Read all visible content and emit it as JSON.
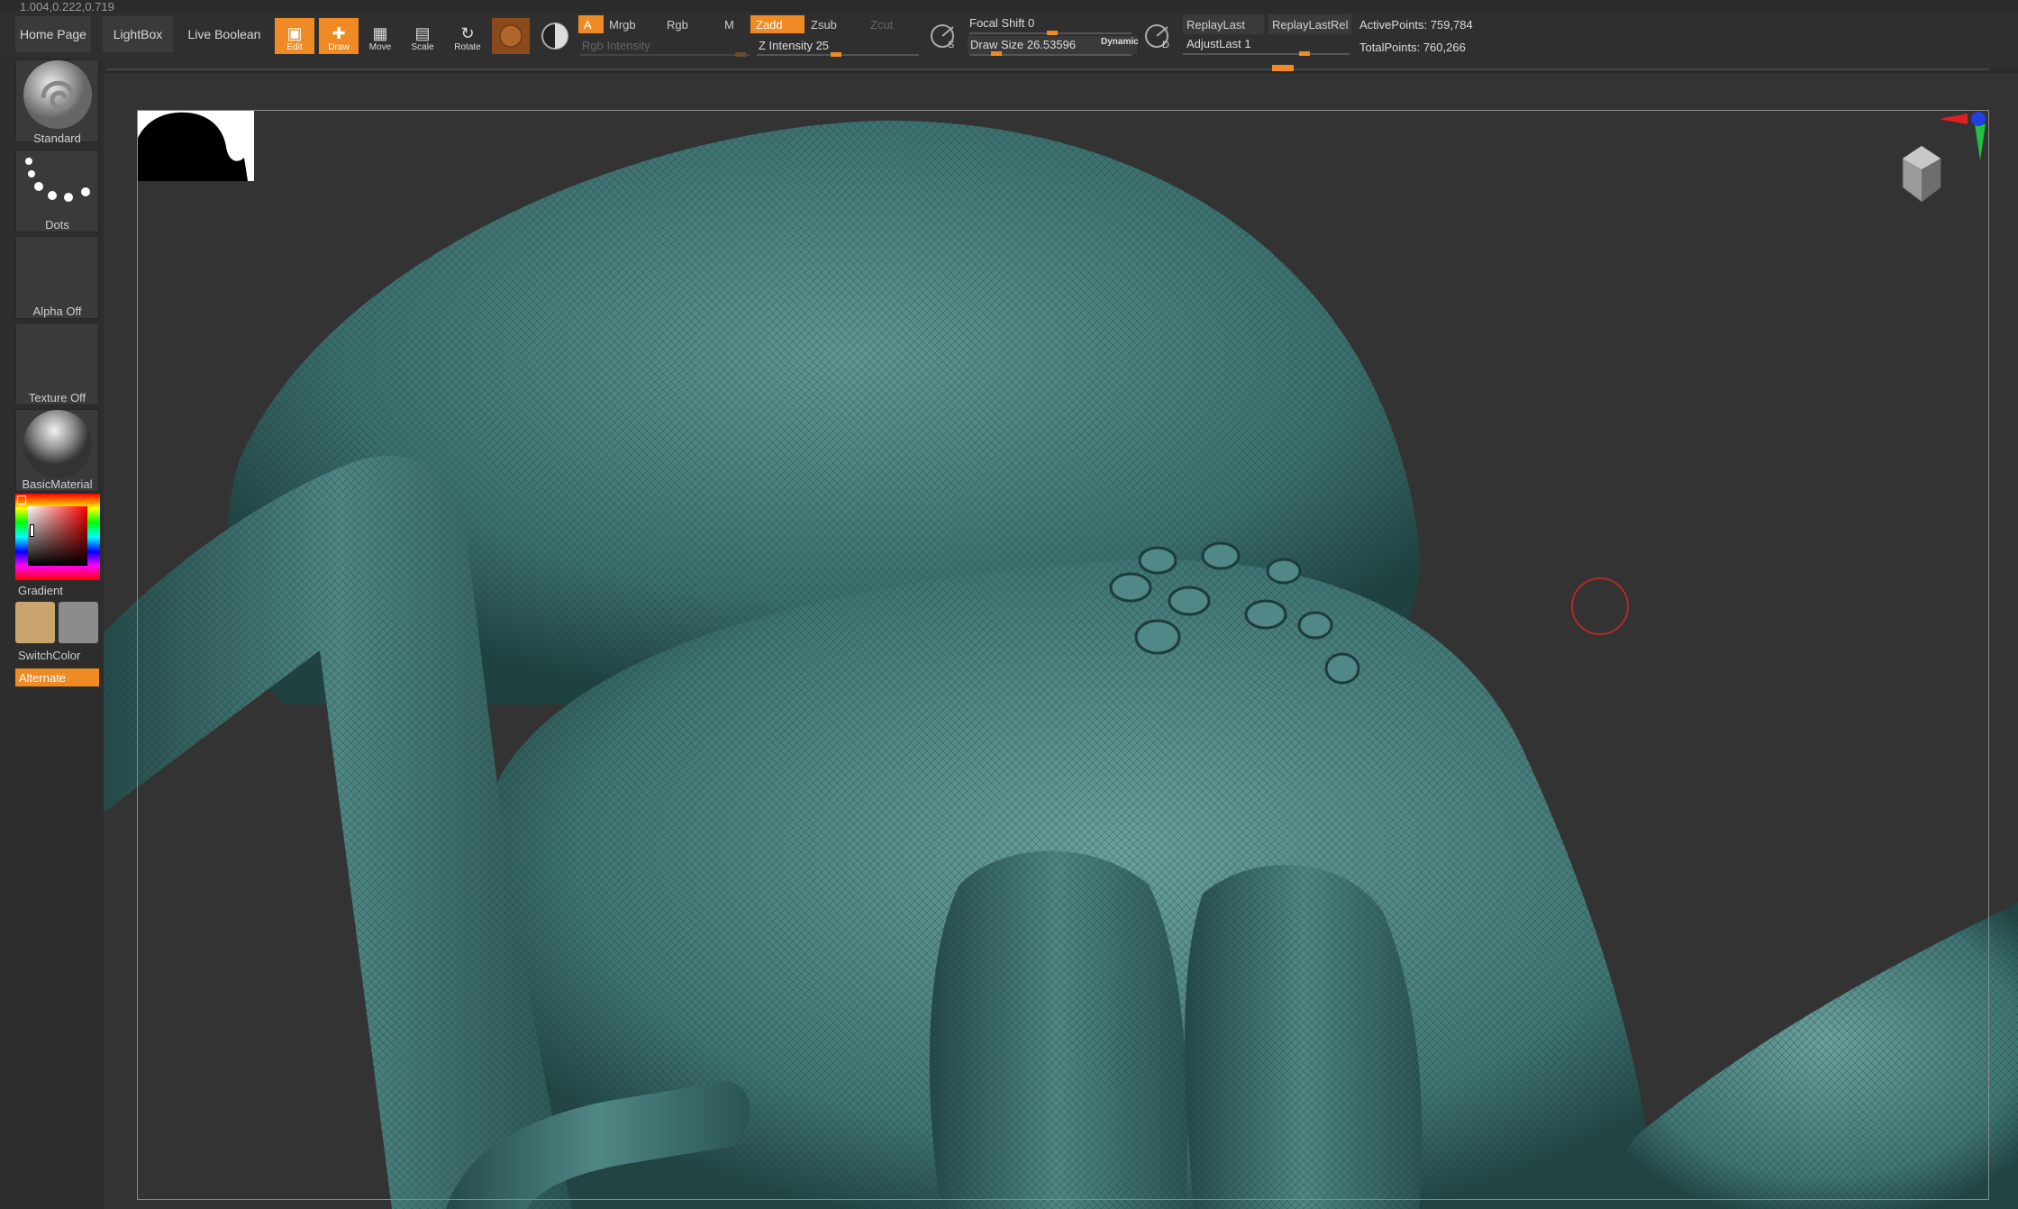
{
  "version": "1.004,0.222,0.719",
  "nav": {
    "home": "Home Page",
    "lightbox": "LightBox",
    "live_boolean": "Live Boolean"
  },
  "tools": {
    "edit": "Edit",
    "draw": "Draw",
    "move": "Move",
    "scale": "Scale",
    "rotate": "Rotate"
  },
  "color_modes": {
    "a": "A",
    "mrgb": "Mrgb",
    "rgb": "Rgb",
    "m": "M",
    "rgb_intensity": "Rgb Intensity"
  },
  "depth_modes": {
    "zadd": "Zadd",
    "zsub": "Zsub",
    "zcut": "Zcut",
    "z_intensity": "Z Intensity 25"
  },
  "brush_settings": {
    "focal_shift": "Focal Shift 0",
    "draw_size": "Draw Size 26.53596",
    "dynamic": "Dynamic",
    "s_key": "S",
    "d_key": "D",
    "focal_shift_value": 0,
    "draw_size_value": 26.53596,
    "z_intensity_value": 25
  },
  "replay": {
    "replay_last": "ReplayLast",
    "replay_last_rel": "ReplayLastRel",
    "adjust_last": "AdjustLast 1"
  },
  "stats": {
    "active_points": "ActivePoints: 759,784",
    "total_points": "TotalPoints: 760,266"
  },
  "left_panel": {
    "brush": "Standard",
    "stroke": "Dots",
    "alpha": "Alpha Off",
    "texture": "Texture Off",
    "material": "BasicMaterial",
    "gradient": "Gradient",
    "switch_color": "SwitchColor",
    "alternate": "Alternate"
  },
  "colors": {
    "accent": "#ef8a24",
    "model": "#3f7a78",
    "primary_swatch": "#c9a46c",
    "secondary_swatch": "#8c8c8c"
  }
}
